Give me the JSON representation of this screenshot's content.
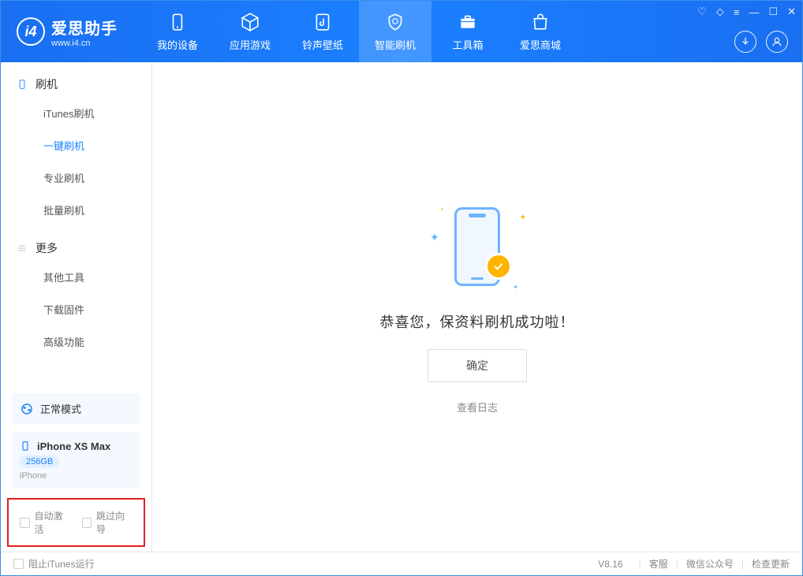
{
  "header": {
    "logo_title": "爱思助手",
    "logo_sub": "www.i4.cn",
    "tabs": [
      {
        "label": "我的设备",
        "icon": "device"
      },
      {
        "label": "应用游戏",
        "icon": "cube"
      },
      {
        "label": "铃声壁纸",
        "icon": "music"
      },
      {
        "label": "智能刷机",
        "icon": "shield",
        "active": true
      },
      {
        "label": "工具箱",
        "icon": "toolbox"
      },
      {
        "label": "爱思商城",
        "icon": "store"
      }
    ]
  },
  "sidebar": {
    "section1_title": "刷机",
    "items1": [
      "iTunes刷机",
      "一键刷机",
      "专业刷机",
      "批量刷机"
    ],
    "active_item": "一键刷机",
    "section2_title": "更多",
    "items2": [
      "其他工具",
      "下载固件",
      "高级功能"
    ],
    "mode_label": "正常模式",
    "device_name": "iPhone XS Max",
    "capacity": "256GB",
    "device_type": "iPhone",
    "chk_auto_activate": "自动激活",
    "chk_skip_guide": "跳过向导"
  },
  "main": {
    "success_text": "恭喜您，保资料刷机成功啦！",
    "ok_button": "确定",
    "log_link": "查看日志"
  },
  "footer": {
    "block_itunes": "阻止iTunes运行",
    "version": "V8.16",
    "links": [
      "客服",
      "微信公众号",
      "检查更新"
    ]
  }
}
